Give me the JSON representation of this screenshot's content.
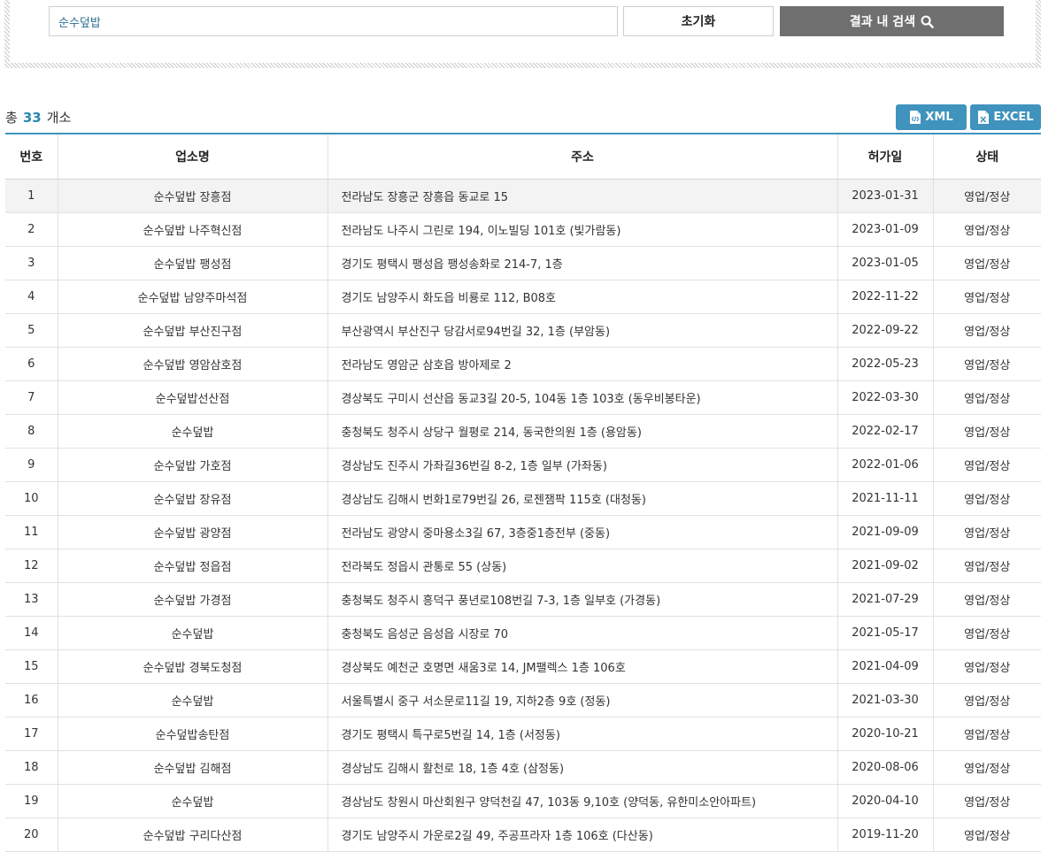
{
  "search": {
    "value": "순수덮밥",
    "reset_label": "초기화",
    "search_in_results_label": "결과 내 검색"
  },
  "summary": {
    "prefix": "총",
    "count": "33",
    "suffix": "개소"
  },
  "export": {
    "xml_label": "XML",
    "excel_label": "EXCEL"
  },
  "table": {
    "columns": [
      "번호",
      "업소명",
      "주소",
      "허가일",
      "상태"
    ],
    "rows": [
      {
        "no": "1",
        "name": "순수덮밥 장흥점",
        "address": "전라남도 장흥군 장흥읍 동교로 15",
        "date": "2023-01-31",
        "status": "영업/정상"
      },
      {
        "no": "2",
        "name": "순수덮밥 나주혁신점",
        "address": "전라남도 나주시 그린로 194, 이노빌딩 101호 (빛가람동)",
        "date": "2023-01-09",
        "status": "영업/정상"
      },
      {
        "no": "3",
        "name": "순수덮밥 팽성점",
        "address": "경기도 평택시 팽성읍 팽성송화로 214-7, 1층",
        "date": "2023-01-05",
        "status": "영업/정상"
      },
      {
        "no": "4",
        "name": "순수덮밥 남양주마석점",
        "address": "경기도 남양주시 화도읍 비룡로 112, B08호",
        "date": "2022-11-22",
        "status": "영업/정상"
      },
      {
        "no": "5",
        "name": "순수덮밥 부산진구점",
        "address": "부산광역시 부산진구 당감서로94번길 32, 1층 (부암동)",
        "date": "2022-09-22",
        "status": "영업/정상"
      },
      {
        "no": "6",
        "name": "순수덮밥 영암삼호점",
        "address": "전라남도 영암군 삼호읍 방아제로 2",
        "date": "2022-05-23",
        "status": "영업/정상"
      },
      {
        "no": "7",
        "name": "순수덮밥선산점",
        "address": "경상북도 구미시 선산읍 동교3길 20-5, 104동 1층 103호 (동우비봉타운)",
        "date": "2022-03-30",
        "status": "영업/정상"
      },
      {
        "no": "8",
        "name": "순수덮밥",
        "address": "충청북도 청주시 상당구 월평로 214, 동국한의원 1층 (용암동)",
        "date": "2022-02-17",
        "status": "영업/정상"
      },
      {
        "no": "9",
        "name": "순수덮밥 가호점",
        "address": "경상남도 진주시 가좌길36번길 8-2, 1층 일부 (가좌동)",
        "date": "2022-01-06",
        "status": "영업/정상"
      },
      {
        "no": "10",
        "name": "순수덮밥 장유점",
        "address": "경상남도 김해시 번화1로79번길 26, 로젠잼팍 115호 (대청동)",
        "date": "2021-11-11",
        "status": "영업/정상"
      },
      {
        "no": "11",
        "name": "순수덮밥 광양점",
        "address": "전라남도 광양시 중마용소3길 67, 3층중1층전부 (중동)",
        "date": "2021-09-09",
        "status": "영업/정상"
      },
      {
        "no": "12",
        "name": "순수덮밥 정읍점",
        "address": "전라북도 정읍시 관통로 55 (상동)",
        "date": "2021-09-02",
        "status": "영업/정상"
      },
      {
        "no": "13",
        "name": "순수덮밥 가경점",
        "address": "충청북도 청주시 흥덕구 풍년로108번길 7-3, 1층 일부호 (가경동)",
        "date": "2021-07-29",
        "status": "영업/정상"
      },
      {
        "no": "14",
        "name": "순수덮밥",
        "address": "충청북도 음성군 음성읍 시장로 70",
        "date": "2021-05-17",
        "status": "영업/정상"
      },
      {
        "no": "15",
        "name": "순수덮밥 경북도청점",
        "address": "경상북도 예천군 호명면 새움3로 14, JM팰렉스 1층 106호",
        "date": "2021-04-09",
        "status": "영업/정상"
      },
      {
        "no": "16",
        "name": "순수덮밥",
        "address": "서울특별시 중구 서소문로11길 19, 지하2층 9호 (정동)",
        "date": "2021-03-30",
        "status": "영업/정상"
      },
      {
        "no": "17",
        "name": "순수덮밥송탄점",
        "address": "경기도 평택시 특구로5번길 14, 1층 (서정동)",
        "date": "2020-10-21",
        "status": "영업/정상"
      },
      {
        "no": "18",
        "name": "순수덮밥 김해점",
        "address": "경상남도 김해시 활천로 18, 1층 4호 (삼정동)",
        "date": "2020-08-06",
        "status": "영업/정상"
      },
      {
        "no": "19",
        "name": "순수덮밥",
        "address": "경상남도 창원시 마산회원구 양덕천길 47, 103동 9,10호 (양덕동, 유한미소안아파트)",
        "date": "2020-04-10",
        "status": "영업/정상"
      },
      {
        "no": "20",
        "name": "순수덮밥 구리다산점",
        "address": "경기도 남양주시 가운로2길 49, 주공프라자 1층 106호 (다산동)",
        "date": "2019-11-20",
        "status": "영업/정상"
      }
    ]
  }
}
